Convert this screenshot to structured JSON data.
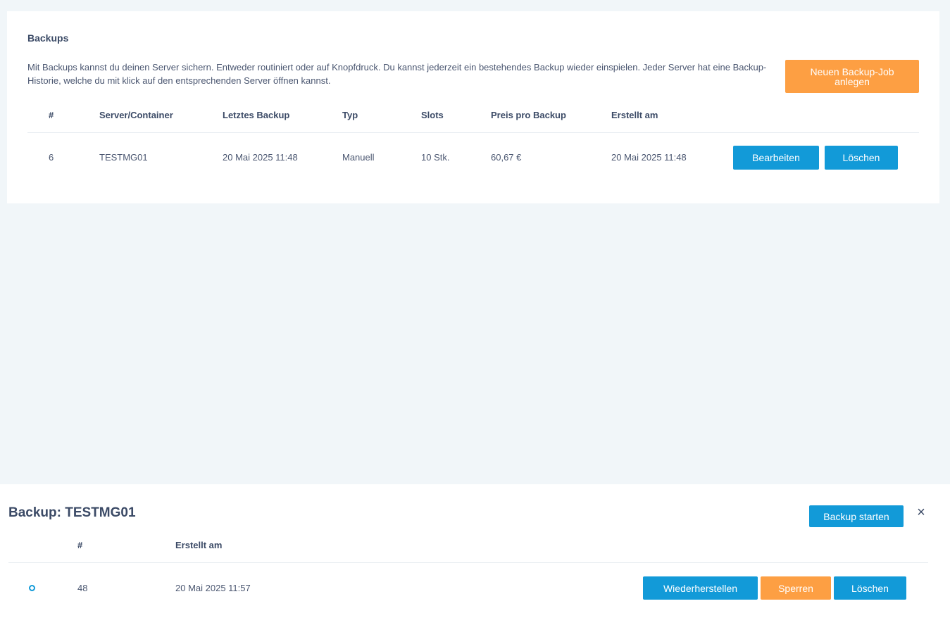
{
  "backups_card": {
    "title": "Backups",
    "description": "Mit Backups kannst du deinen Server sichern. Entweder routiniert oder auf Knopfdruck. Du kannst jederzeit ein bestehendes Backup wieder einspielen. Jeder Server hat eine Backup-Historie, welche du mit klick auf den entsprechenden Server öffnen kannst.",
    "new_job_button": "Neuen Backup-Job anlegen",
    "columns": [
      "#",
      "Server/Container",
      "Letztes Backup",
      "Typ",
      "Slots",
      "Preis pro Backup",
      "Erstellt am"
    ],
    "rows": [
      {
        "id": "6",
        "server": "TESTMG01",
        "last_backup": "20 Mai 2025 11:48",
        "type": "Manuell",
        "slots": "10 Stk.",
        "price": "60,67 €",
        "created": "20 Mai 2025 11:48",
        "edit_label": "Bearbeiten",
        "delete_label": "Löschen"
      }
    ]
  },
  "history_panel": {
    "title": "Backup: TESTMG01",
    "start_button": "Backup starten",
    "close_icon": "×",
    "columns": [
      "#",
      "Erstellt am"
    ],
    "rows": [
      {
        "id": "48",
        "created": "20 Mai 2025 11:57",
        "restore_label": "Wiederherstellen",
        "lock_label": "Sperren",
        "delete_label": "Löschen"
      }
    ]
  },
  "colors": {
    "primary": "#129ad8",
    "accent": "#fd9f43",
    "background": "#f1f6f9",
    "text": "#3b4a66"
  }
}
